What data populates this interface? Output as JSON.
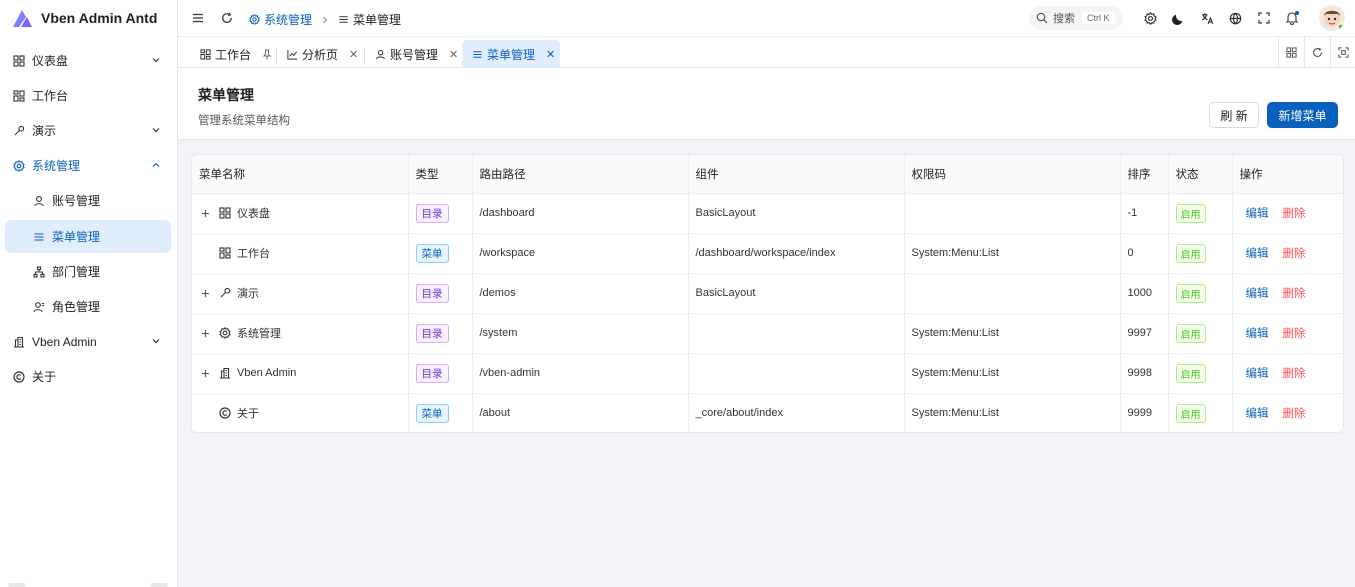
{
  "app": {
    "title": "Vben Admin Antd"
  },
  "sidebar": {
    "items": [
      {
        "label": "仪表盘",
        "icon": "dashboard-grid-icon",
        "expandable": true
      },
      {
        "label": "工作台",
        "icon": "workbench-icon"
      },
      {
        "label": "演示",
        "icon": "wrench-icon",
        "expandable": true
      },
      {
        "label": "系统管理",
        "icon": "gear-icon",
        "expanded": true
      },
      {
        "label": "账号管理",
        "icon": "user-icon"
      },
      {
        "label": "菜单管理",
        "icon": "menu-list-icon",
        "active": true
      },
      {
        "label": "部门管理",
        "icon": "org-chart-icon"
      },
      {
        "label": "角色管理",
        "icon": "user-role-icon"
      },
      {
        "label": "Vben Admin",
        "icon": "building-icon",
        "expandable": true
      },
      {
        "label": "关于",
        "icon": "copyright-icon"
      }
    ]
  },
  "header": {
    "breadcrumb": [
      {
        "label": "系统管理",
        "icon": "gear-icon"
      },
      {
        "label": "菜单管理",
        "icon": "menu-list-icon"
      }
    ],
    "search": {
      "placeholder": "搜索",
      "shortcut": "Ctrl K"
    }
  },
  "tabs": [
    {
      "label": "工作台",
      "icon": "workbench-icon",
      "pinned": true
    },
    {
      "label": "分析页",
      "icon": "line-chart-icon"
    },
    {
      "label": "账号管理",
      "icon": "user-icon"
    },
    {
      "label": "菜单管理",
      "icon": "menu-list-icon",
      "active": true
    }
  ],
  "page": {
    "title": "菜单管理",
    "subtitle": "管理系统菜单结构",
    "refresh_label": "刷 新",
    "add_label": "新增菜单"
  },
  "table": {
    "columns": [
      "菜单名称",
      "类型",
      "路由路径",
      "组件",
      "权限码",
      "排序",
      "状态",
      "操作"
    ],
    "rows": [
      {
        "name": "仪表盘",
        "icon": "dashboard-grid-icon",
        "expandable": true,
        "type": "目录",
        "type_kind": "dir",
        "path": "/dashboard",
        "component": "BasicLayout",
        "perm": "",
        "order": "-1",
        "status": "启用"
      },
      {
        "name": "工作台",
        "icon": "workbench-icon",
        "expandable": false,
        "type": "菜单",
        "type_kind": "menu",
        "path": "/workspace",
        "component": "/dashboard/workspace/index",
        "perm": "System:Menu:List",
        "order": "0",
        "status": "启用"
      },
      {
        "name": "演示",
        "icon": "wrench-icon",
        "expandable": true,
        "type": "目录",
        "type_kind": "dir",
        "path": "/demos",
        "component": "BasicLayout",
        "perm": "",
        "order": "1000",
        "status": "启用"
      },
      {
        "name": "系统管理",
        "icon": "gear-icon",
        "expandable": true,
        "type": "目录",
        "type_kind": "dir",
        "path": "/system",
        "component": "",
        "perm": "System:Menu:List",
        "order": "9997",
        "status": "启用"
      },
      {
        "name": "Vben Admin",
        "icon": "building-icon",
        "expandable": true,
        "type": "目录",
        "type_kind": "dir",
        "path": "/vben-admin",
        "component": "",
        "perm": "System:Menu:List",
        "order": "9998",
        "status": "启用"
      },
      {
        "name": "关于",
        "icon": "copyright-icon",
        "expandable": false,
        "type": "菜单",
        "type_kind": "menu",
        "path": "/about",
        "component": "_core/about/index",
        "perm": "System:Menu:List",
        "order": "9999",
        "status": "启用"
      }
    ],
    "actions": {
      "edit": "编辑",
      "delete": "删除"
    }
  },
  "colors": {
    "primary": "#0960bd",
    "active_bg": "#e0edfd",
    "danger": "#ff4d4f",
    "success": "#52c41a",
    "dir_tag": "#722ed1"
  }
}
